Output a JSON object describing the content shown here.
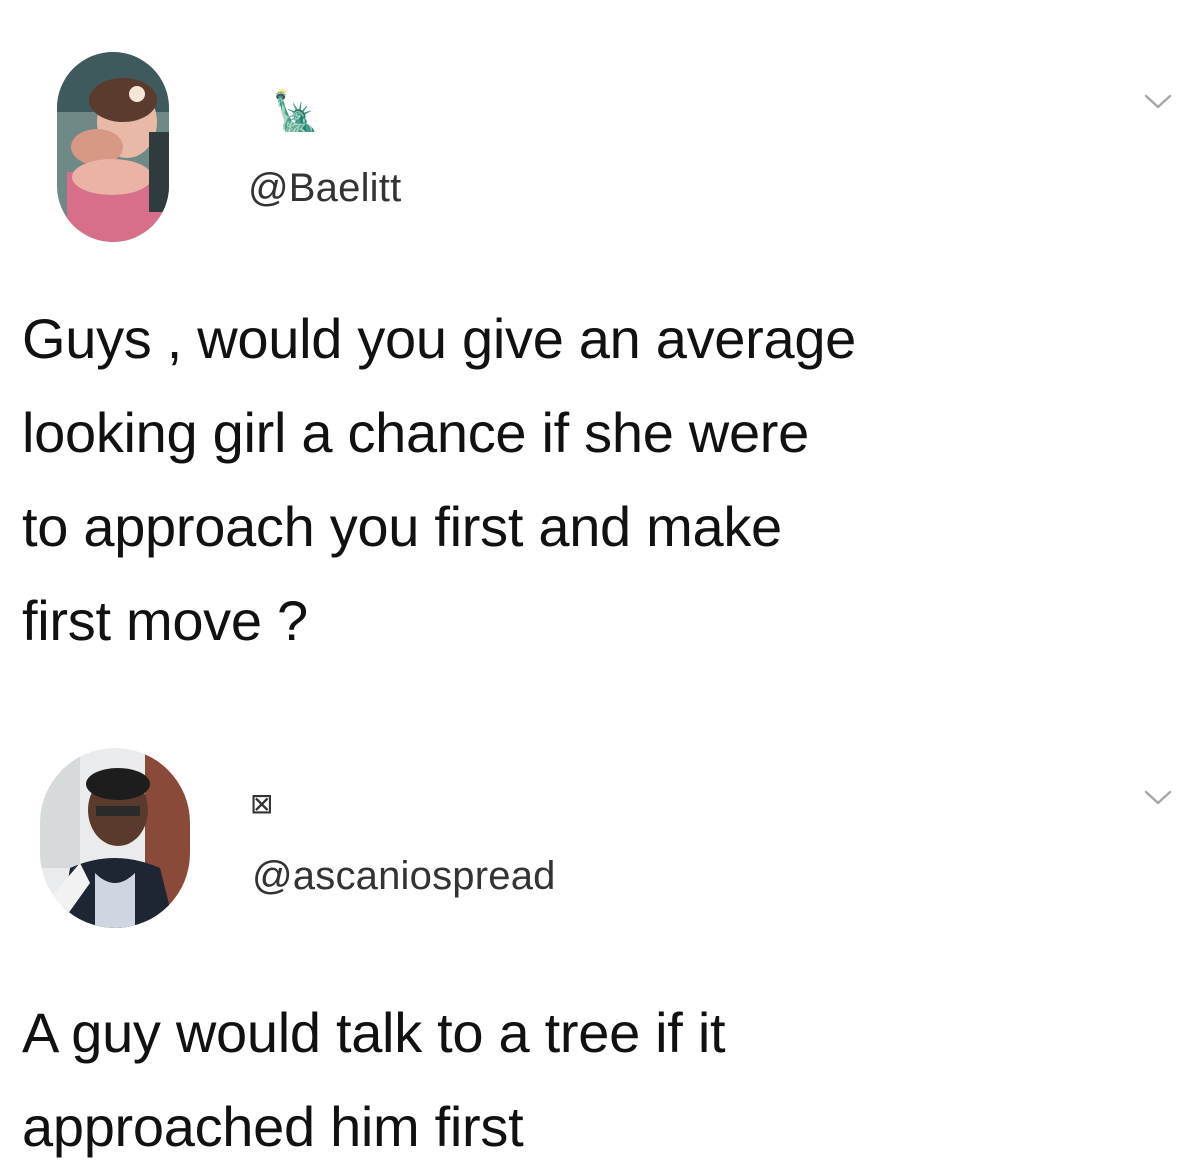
{
  "tweets": [
    {
      "display_name": "🗽",
      "handle": "@Baelitt",
      "avatar_icon": "profile-photo-woman",
      "menu_icon": "chevron-down-icon",
      "text": "Guys , would you give an average\nlooking girl a chance if she were\nto approach you first and make\nfirst move ?"
    },
    {
      "display_name": "⊠",
      "handle": "@ascaniospread",
      "avatar_icon": "profile-photo-man",
      "menu_icon": "chevron-down-icon",
      "text": "A guy would talk to a tree if it\napproached him first"
    }
  ],
  "colors": {
    "background": "#ffffff",
    "text": "#111111",
    "handle": "#333333",
    "chevron": "#a8a8a8"
  }
}
